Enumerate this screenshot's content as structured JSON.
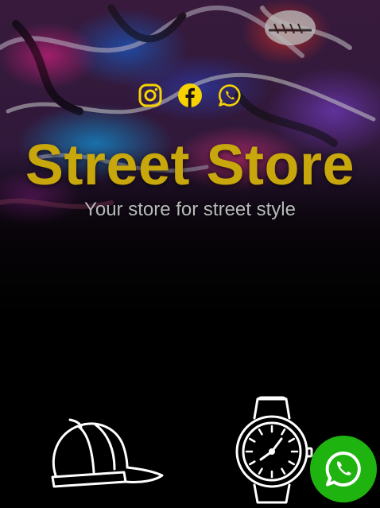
{
  "hero": {
    "title": "Street Store",
    "subtitle": "Your store for street style",
    "background_image": "graffiti-wall"
  },
  "socials": [
    {
      "name": "instagram",
      "icon": "instagram-icon"
    },
    {
      "name": "facebook",
      "icon": "facebook-icon"
    },
    {
      "name": "whatsapp",
      "icon": "whatsapp-icon"
    }
  ],
  "products": [
    {
      "icon": "cap-icon"
    },
    {
      "icon": "watch-icon"
    }
  ],
  "floating_button": {
    "icon": "whatsapp-icon"
  },
  "colors": {
    "title": "#c8a70c",
    "social_icons": "#f5d200",
    "subtitle": "#b9b9b9",
    "background": "#000000",
    "whatsapp_button": "#1fb30f"
  }
}
